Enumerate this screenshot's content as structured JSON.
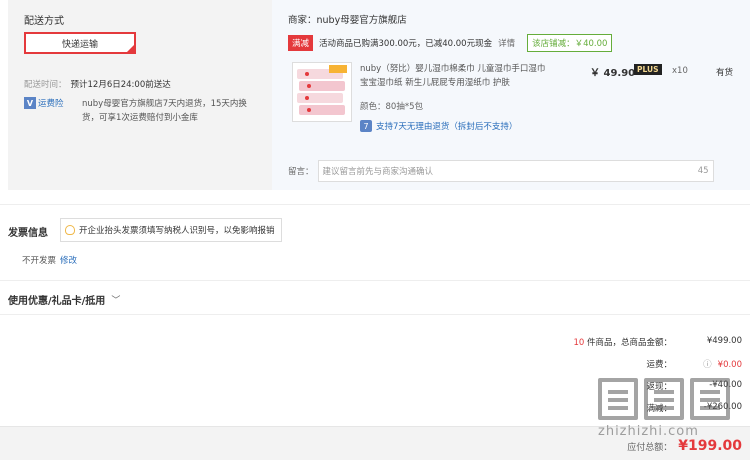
{
  "shipping": {
    "title": "配送方式",
    "method": "快递运输",
    "time_label": "配送时间：",
    "time_value": "预计12月6日24:00前送达",
    "insurance_icon": "V",
    "insurance_label": "运费险",
    "insurance_text": "nuby母婴官方旗舰店7天内退货，15天内换货，可享1次运费赔付到小金库"
  },
  "shop": {
    "name": "商家：nuby母婴官方旗舰店",
    "promo_tag": "满减",
    "promo_text": "活动商品已购满300.00元，已减40.00元现金",
    "promo_detail": "详情",
    "promo_save": "该店铺减：￥40.00",
    "product": {
      "name": "nuby（努比）婴儿湿巾棉柔巾 儿童湿巾手口湿巾 宝宝湿巾纸 新生儿屁屁专用湿纸巾 护肤",
      "color": "颜色：80抽*5包",
      "refund_icon": "7",
      "refund": "支持7天无理由退货（拆封后不支持）",
      "price": "￥ 49.90",
      "plus": "PLUS",
      "qty": "x10",
      "stock": "有货",
      "thumb_brand": "nuby"
    },
    "message": {
      "label": "留言：",
      "placeholder": "建议留言前先与商家沟通确认",
      "count": "45"
    }
  },
  "invoice": {
    "title": "发票信息",
    "tip": "开企业抬头发票须填写纳税人识别号，以免影响报销",
    "value": "不开发票",
    "edit": "修改"
  },
  "coupon": {
    "title": "使用优惠/礼品卡/抵用",
    "chevron": "﹀"
  },
  "summary": {
    "count": "10",
    "count_label": " 件商品，总商品金额：",
    "total": "¥499.00",
    "shipping_label": "运费：",
    "shipping_value": "¥0.00",
    "discount_label": "返现：",
    "discount_value": "-¥40.00",
    "reduction_label": "满减：",
    "reduction_value": "-¥260.00",
    "payable_label": "应付总额：",
    "payable_value": "¥199.00"
  },
  "watermark": {
    "text": "zhizhizhi.com"
  },
  "colors": {
    "accent_red": "#e4393c",
    "link_blue": "#2a6ebb",
    "save_green": "#65ad3b"
  }
}
